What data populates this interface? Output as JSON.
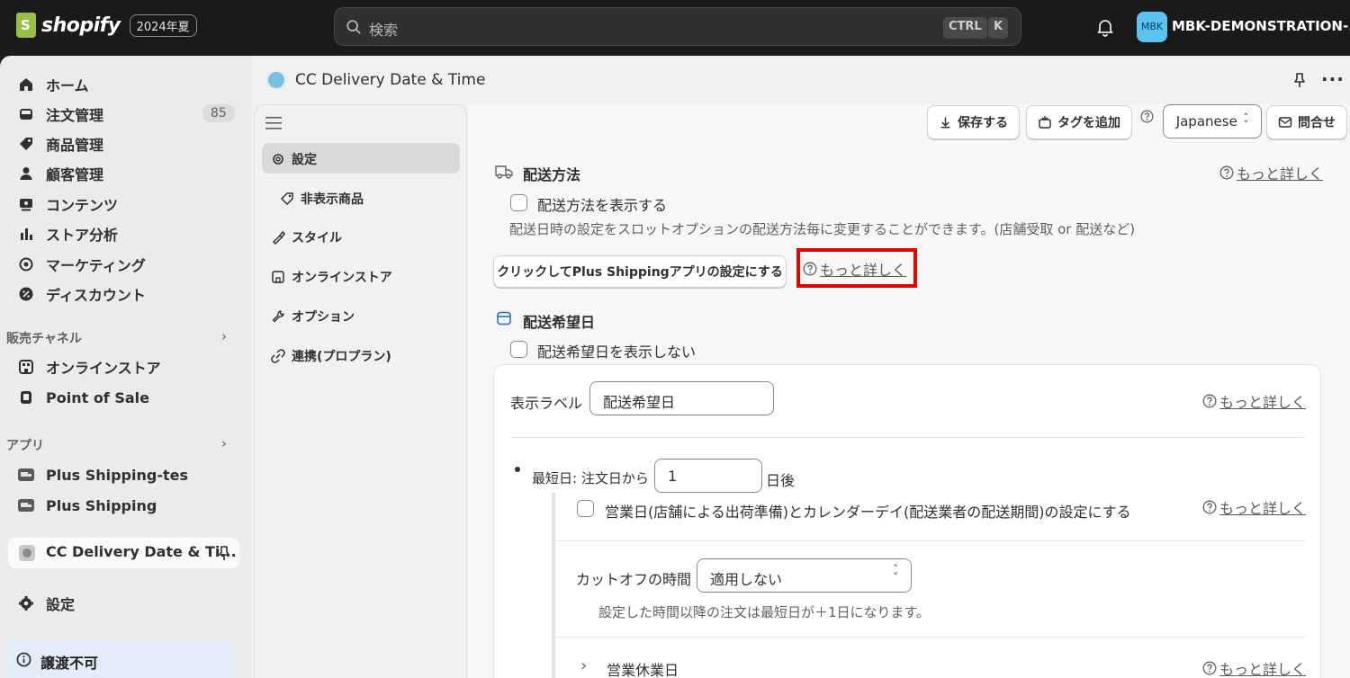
{
  "topbar": {
    "logo_text": "shopify",
    "edition_badge": "2024年夏",
    "search_placeholder": "検索",
    "kbd_ctrl": "CTRL",
    "kbd_k": "K",
    "avatar_initials": "MBK",
    "store_name": "MBK-DEMONSTRATION-..."
  },
  "sidebar": {
    "items": [
      {
        "label": "ホーム",
        "icon": "home-icon"
      },
      {
        "label": "注文管理",
        "icon": "inbox-icon",
        "count": "85"
      },
      {
        "label": "商品管理",
        "icon": "tag-icon"
      },
      {
        "label": "顧客管理",
        "icon": "person-icon"
      },
      {
        "label": "コンテンツ",
        "icon": "image-icon"
      },
      {
        "label": "ストア分析",
        "icon": "bar-chart-icon"
      },
      {
        "label": "マーケティング",
        "icon": "target-icon"
      },
      {
        "label": "ディスカウント",
        "icon": "discount-icon"
      }
    ],
    "sales_channels_heading": "販売チャネル",
    "sales_channels": [
      {
        "label": "オンラインストア",
        "icon": "store-icon"
      },
      {
        "label": "Point of Sale",
        "icon": "pos-icon"
      }
    ],
    "apps_heading": "アプリ",
    "apps": [
      {
        "label": "Plus Shipping-tes",
        "icon": "truck-app-icon"
      },
      {
        "label": "Plus Shipping",
        "icon": "truck-app-icon"
      }
    ],
    "pinned_app": "CC Delivery Date & Ti...",
    "settings_label": "設定",
    "nontransferable_label": "譲渡不可"
  },
  "app": {
    "title": "CC Delivery Date & Time",
    "subnav": [
      {
        "label": "設定",
        "icon": "gear-icon"
      },
      {
        "label": "非表示商品",
        "icon": "tag-icon"
      },
      {
        "label": "スタイル",
        "icon": "brush-icon"
      },
      {
        "label": "オンラインストア",
        "icon": "store-icon"
      },
      {
        "label": "オプション",
        "icon": "wrench-icon"
      },
      {
        "label": "連携(プロプラン)",
        "icon": "link-icon"
      }
    ],
    "toolbar": {
      "save": "保存する",
      "add_tag": "タグを追加",
      "language": "Japanese",
      "contact": "問合せ"
    },
    "shipping": {
      "title": "配送方法",
      "learn_more": "もっと詳しく",
      "show_checkbox_label": "配送方法を表示する",
      "description": "配送日時の設定をスロットオプションの配送方法毎に変更することができます。(店舗受取 or 配送など)",
      "plus_button": "クリックしてPlus Shippingアプリの設定にする",
      "plus_learn_more": "もっと詳しく"
    },
    "desired_date": {
      "title": "配送希望日",
      "hide_checkbox_label": "配送希望日を表示しない",
      "display_label_caption": "表示ラベル",
      "display_label_value": "配送希望日",
      "learn_more": "もっと詳しく",
      "earliest_prefix": "最短日: 注文日から",
      "earliest_value": "1",
      "earliest_suffix": "日後",
      "business_day_label": "営業日(店舗による出荷準備)とカレンダーデイ(配送業者の配送期間)の設定にする",
      "business_day_learn_more": "もっと詳しく",
      "cutoff_label": "カットオフの時間",
      "cutoff_value": "適用しない",
      "cutoff_note": "設定した時間以降の注文は最短日が＋1日になります。",
      "holidays_label": "営業休業日",
      "holidays_learn_more": "もっと詳しく"
    }
  },
  "colors": {
    "topbar_bg": "#1a1a1a",
    "brand_green": "#95bf47",
    "highlight_red": "#e00000"
  }
}
